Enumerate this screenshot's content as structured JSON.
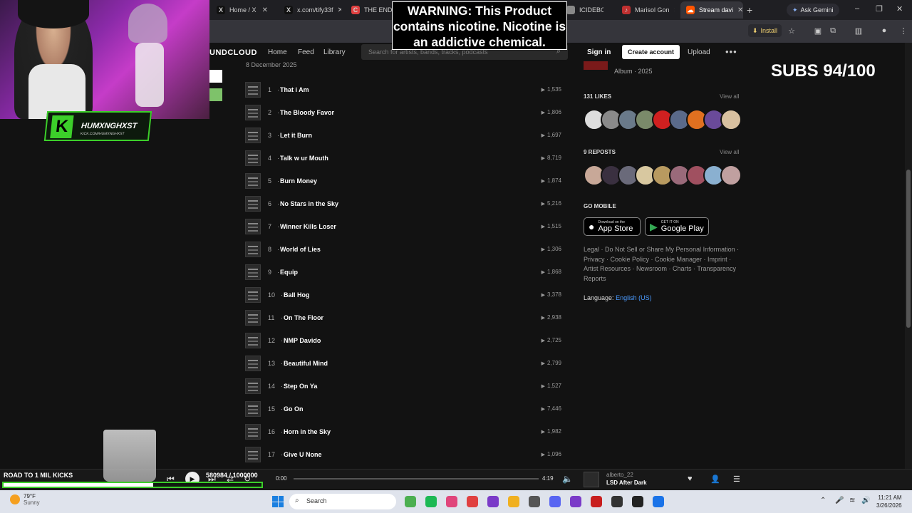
{
  "browser": {
    "tabs": [
      {
        "title": "Home / X",
        "fav": "X",
        "favColor": "#111111",
        "active": false
      },
      {
        "title": "x.com/tify33f",
        "fav": "X",
        "favColor": "#111111",
        "active": false
      },
      {
        "title": "THE END OF",
        "fav": "C",
        "favColor": "#e04040",
        "active": false
      },
      {
        "title": "ICIDEBOY",
        "fav": "",
        "favColor": "#888888",
        "active": false
      },
      {
        "title": "Marisol Gon",
        "fav": "♪",
        "favColor": "#c03030",
        "active": false
      },
      {
        "title": "Stream davi",
        "fav": "☁",
        "favColor": "#ff5500",
        "active": true
      }
    ],
    "ask_gemini": "Ask Gemini",
    "install_label": "Install"
  },
  "soundcloud": {
    "logo": "UNDCLOUD",
    "nav": {
      "home": "Home",
      "feed": "Feed",
      "library": "Library"
    },
    "search_placeholder": "Search for artists, bands, tracks, podcasts",
    "sign_in": "Sign in",
    "create_account": "Create account",
    "upload": "Upload",
    "release_date": "8 December 2025"
  },
  "tracks": [
    {
      "num": "1",
      "title": "That i Am",
      "plays": "1,535"
    },
    {
      "num": "2",
      "title": "The Bloody Favor",
      "plays": "1,806"
    },
    {
      "num": "3",
      "title": "Let it Burn",
      "plays": "1,697"
    },
    {
      "num": "4",
      "title": "Talk w ur Mouth",
      "plays": "8,719"
    },
    {
      "num": "5",
      "title": "Burn Money",
      "plays": "1,874"
    },
    {
      "num": "6",
      "title": "No Stars in the Sky",
      "plays": "5,216"
    },
    {
      "num": "7",
      "title": "Winner Kills Loser",
      "plays": "1,515"
    },
    {
      "num": "8",
      "title": "World of Lies",
      "plays": "1,306"
    },
    {
      "num": "9",
      "title": "Equip",
      "plays": "1,868"
    },
    {
      "num": "10",
      "title": "Ball Hog",
      "plays": "3,378"
    },
    {
      "num": "11",
      "title": "On The Floor",
      "plays": "2,938"
    },
    {
      "num": "12",
      "title": "NMP Davido",
      "plays": "2,725"
    },
    {
      "num": "13",
      "title": "Beautiful Mind",
      "plays": "2,799"
    },
    {
      "num": "14",
      "title": "Step On Ya",
      "plays": "1,527"
    },
    {
      "num": "15",
      "title": "Go On",
      "plays": "7,446"
    },
    {
      "num": "16",
      "title": "Horn in the Sky",
      "plays": "1,982"
    },
    {
      "num": "17",
      "title": "Give U None",
      "plays": "1,096"
    }
  ],
  "sidebar": {
    "album_info": "Album · 2025",
    "likes_heading": "131 LIKES",
    "reposts_heading": "9 REPOSTS",
    "view_all": "View all",
    "go_mobile": "GO MOBILE",
    "app_store_small": "Download on the",
    "app_store_big": "App Store",
    "google_play_small": "GET IT ON",
    "google_play_big": "Google Play",
    "footer_links": "Legal · Do Not Sell or Share My Personal Information · Privacy · Cookie Policy · Cookie Manager · Imprint · Artist Resources · Newsroom · Charts · Transparency Reports",
    "language_label": "Language:",
    "language_value": "English (US)",
    "like_colors": [
      "#dddddd",
      "#8a8a8a",
      "#6a7a8a",
      "#7a8a6a",
      "#d02020",
      "#5a6a8a",
      "#e07020",
      "#6a4a9a",
      "#d8c0a0"
    ],
    "repost_colors": [
      "#c8a898",
      "#3a3040",
      "#6a6a7a",
      "#d8c8a0",
      "#b89a60",
      "#9a6a7a",
      "#a05060",
      "#8ab0d0",
      "#c0a0a0"
    ]
  },
  "overlay": {
    "warning": "WARNING: This Product contains nicotine. Nicotine is an addictive chemical.",
    "subs": "SUBS 94/100",
    "kick_name": "HUMXNGHXST",
    "kick_url": "KICK.COM/HUMXNGHXST",
    "goal_label": "ROAD TO 1 MIL KICKS",
    "goal_current": "580984",
    "goal_total": "/ 1000000",
    "goal_fraction": 0.580984
  },
  "player": {
    "time_current": "0:00",
    "time_total": "4:19",
    "artist": "alberto_22",
    "title": "LSD After Dark"
  },
  "taskbar": {
    "temp": "79°F",
    "condition": "Sunny",
    "search": "Search",
    "time": "11:21 AM",
    "date": "3/26/2026",
    "app_colors": [
      "#4caf50",
      "#1db954",
      "#e0457b",
      "#e04040",
      "#7a3ac8",
      "#f0b020",
      "#555555",
      "#5865f2",
      "#7a3ac8",
      "#c81e1e",
      "#333333",
      "#222222",
      "#1a73e8"
    ]
  }
}
